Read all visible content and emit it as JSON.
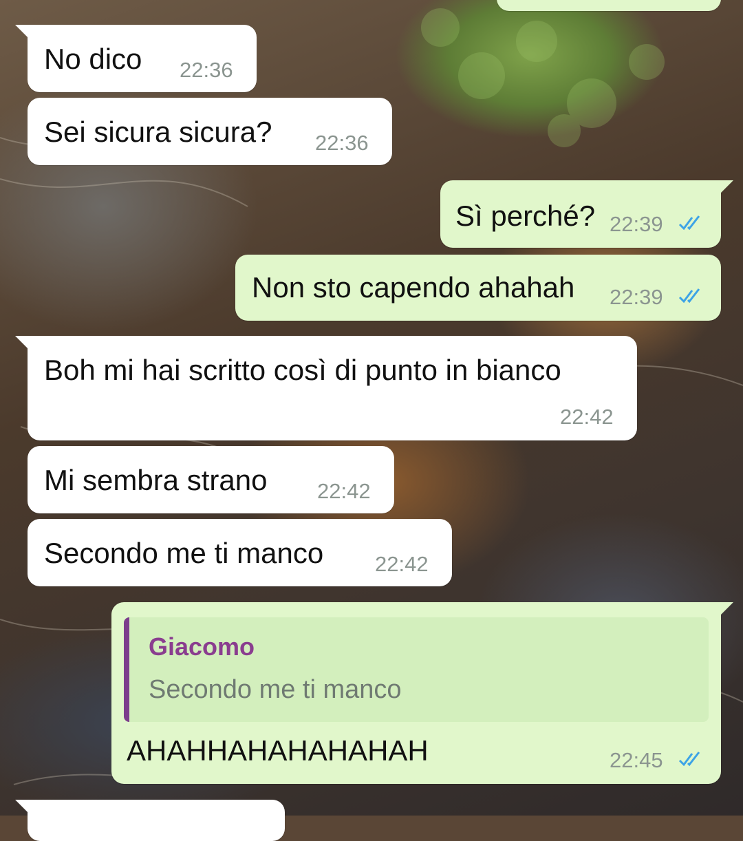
{
  "messages": [
    {
      "text": "No dico",
      "time": "22:36"
    },
    {
      "text": "Sei sicura sicura?",
      "time": "22:36"
    },
    {
      "text": "Sì perché?",
      "time": "22:39"
    },
    {
      "text": "Non sto capendo ahahah",
      "time": "22:39"
    },
    {
      "text": "Boh mi hai scritto così di punto in bianco",
      "time": "22:42"
    },
    {
      "text": "Mi sembra strano",
      "time": "22:42"
    },
    {
      "text": "Secondo me ti manco",
      "time": "22:42"
    },
    {
      "text": "AHAHHAHAHAHAHAH",
      "time": "22:45",
      "reply_to": {
        "name": "Giacomo",
        "text": "Secondo me ti manco"
      }
    }
  ],
  "icons": {
    "read_receipt": "double-check-icon"
  },
  "colors": {
    "outgoing": "#e1f7cb",
    "incoming": "#ffffff",
    "read_ticks": "#3da3e6",
    "reply_name": "#8a3d8f"
  }
}
